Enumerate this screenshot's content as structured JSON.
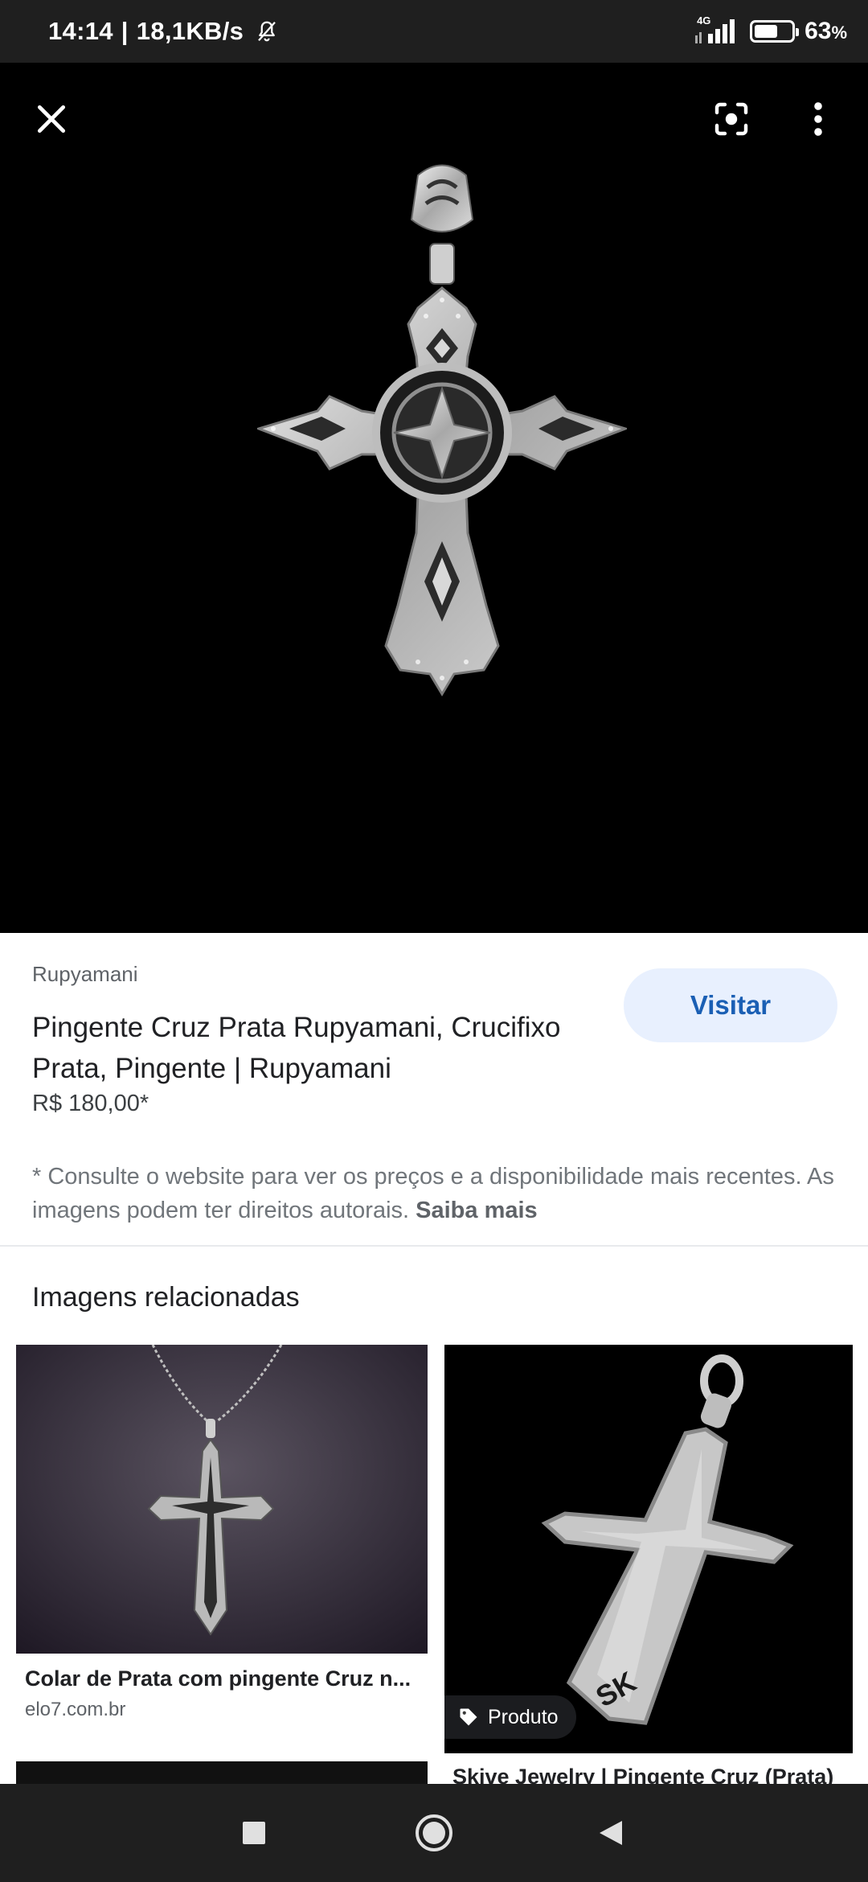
{
  "status_bar": {
    "time": "14:14",
    "separator": "|",
    "net_speed": "18,1KB/s",
    "network_type": "4G",
    "battery_percent": "63",
    "battery_unit": "%",
    "battery_level": 0.63
  },
  "viewer": {
    "close_icon": "close-icon",
    "lens_icon": "lens-search-icon",
    "more_icon": "more-vert-icon"
  },
  "product": {
    "source": "Rupyamani",
    "title": "Pingente Cruz Prata Rupyamani, Crucifixo Prata, Pingente | Rupyamani",
    "price": "R$ 180,00*",
    "visit_label": "Visitar",
    "disclaimer": "* Consulte o website para ver os preços e a disponibilidade mais recentes. As imagens podem ter direitos autorais.",
    "learn_more": "Saiba mais"
  },
  "related": {
    "heading": "Imagens relacionadas",
    "items": [
      {
        "title": "Colar de Prata com pingente Cruz n...",
        "domain": "elo7.com.br"
      },
      {
        "title": "Skive Jewelry | Pingente Cruz (Prata)",
        "tag": "Produto"
      }
    ]
  },
  "colors": {
    "status_bg": "#1f1f1f",
    "viewer_bg": "#000000",
    "accent": "#1a5fb4",
    "visit_bg": "#e8f0fe"
  }
}
